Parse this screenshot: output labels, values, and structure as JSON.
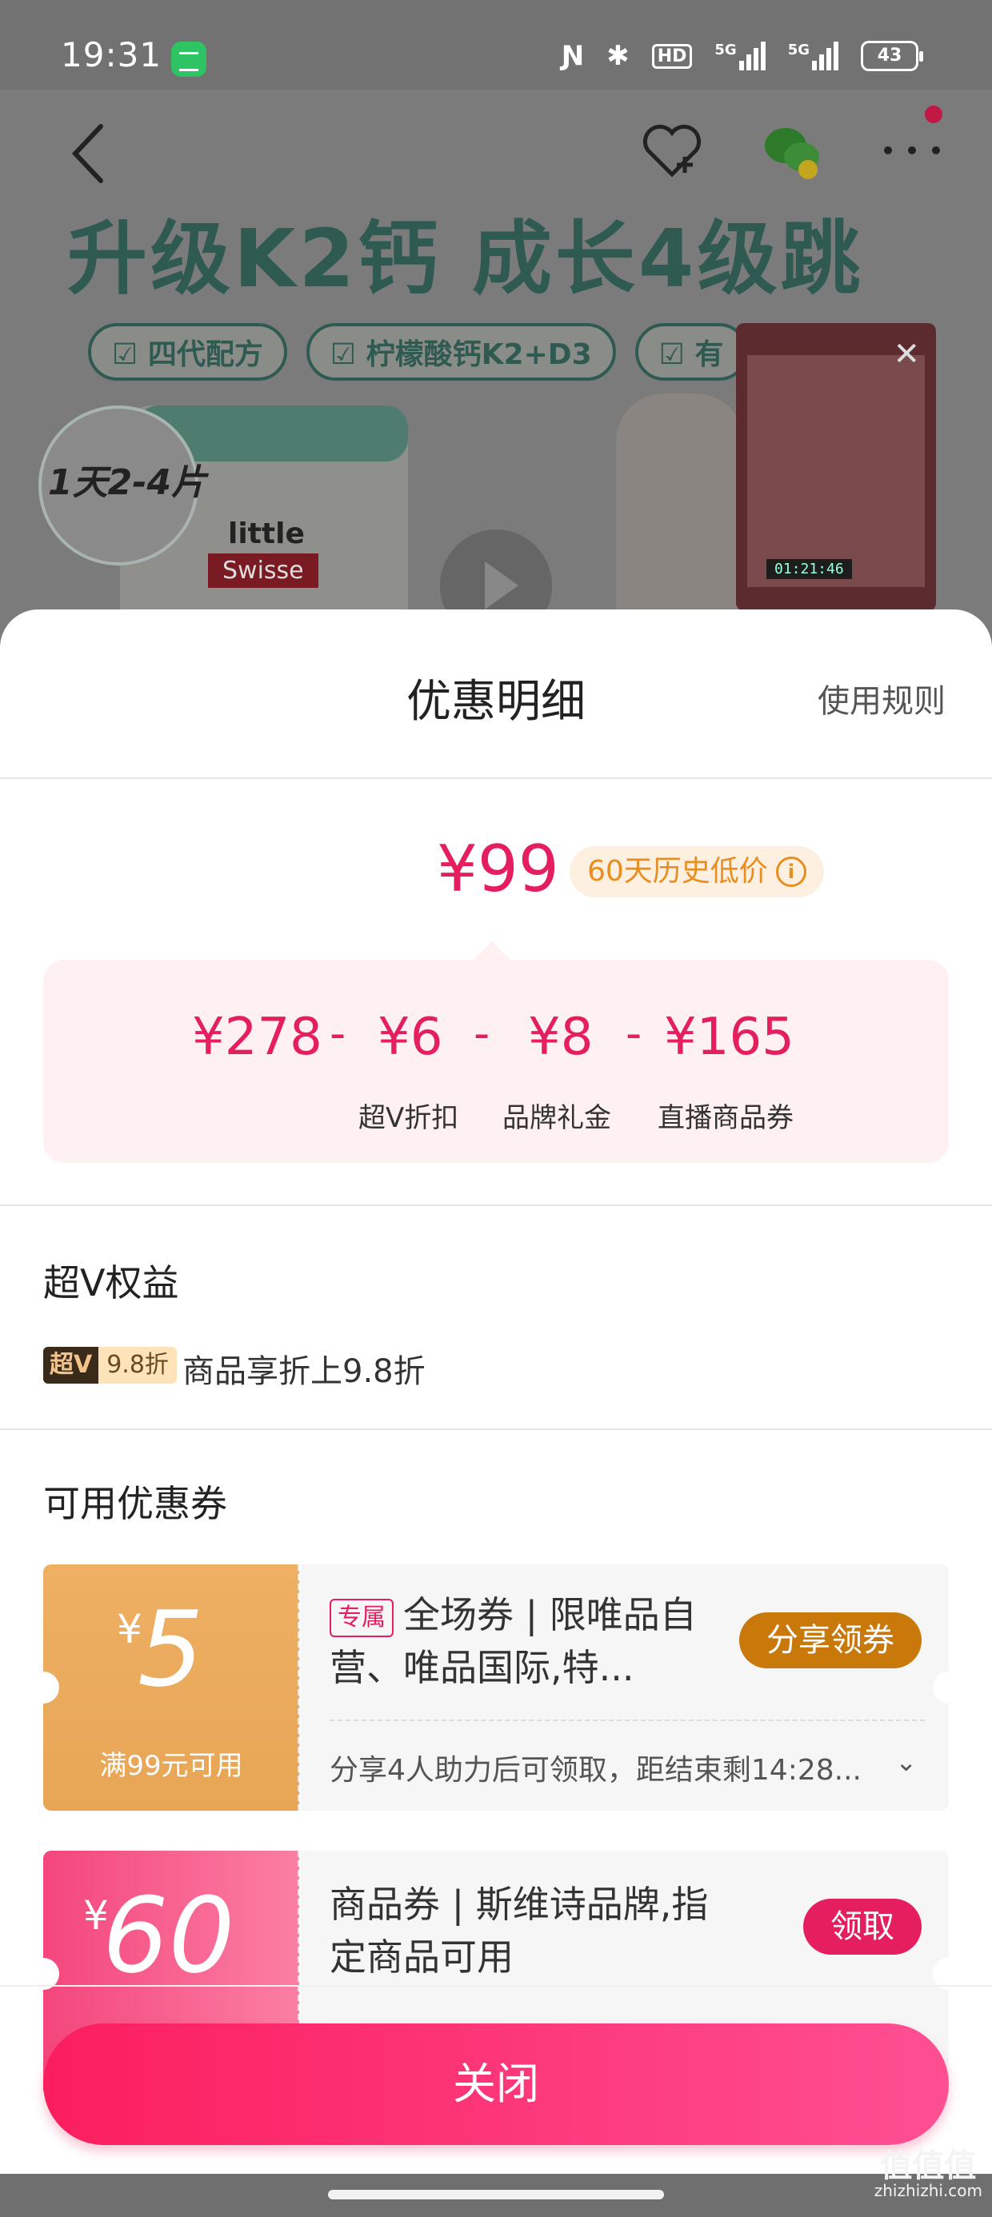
{
  "status_bar": {
    "time": "19:31",
    "battery": "43",
    "network1": "5G",
    "network2": "5G",
    "hd": "HD"
  },
  "banner": {
    "headline": "升级K2钙 成长4级跳",
    "tags": [
      "四代配方",
      "柠檬酸钙K2+D3",
      "有"
    ],
    "badge": "1天2-4片",
    "brand_small": "little",
    "brand_name": "Swisse",
    "live_timer": "01:21:46"
  },
  "sheet": {
    "title": "优惠明细",
    "rules_link": "使用规则",
    "final_price": "¥99",
    "history_badge": "60天历史低价",
    "calc": {
      "original": "¥278",
      "op1": "-",
      "discount1": "¥6",
      "op2": "-",
      "discount2": "¥8",
      "op3": "-",
      "discount3": "¥165",
      "label1": "超V折扣",
      "label2": "品牌礼金",
      "label3": "直播商品券"
    },
    "vip_section": {
      "title": "超V权益",
      "badge_v": "超V",
      "badge_discount": "9.8折",
      "desc": "商品享折上9.8折"
    },
    "coupon_section": {
      "title": "可用优惠券",
      "coupons": [
        {
          "yen": "¥",
          "amount": "5",
          "condition": "满99元可用",
          "exclusive": "专属",
          "title": "全场券 | 限唯品自营、唯品国际,特...",
          "button": "分享领券",
          "note": "分享4人助力后可领取，距结束剩14:28..."
        },
        {
          "yen": "¥",
          "amount": "60",
          "title": "商品券 | 斯维诗品牌,指定商品可用",
          "button": "领取"
        }
      ]
    },
    "close_button": "关闭"
  },
  "watermark": {
    "main": "值值值",
    "sub": "zhizhizhi.com"
  },
  "colors": {
    "accent": "#e51f5f",
    "gold": "#eeb063",
    "pink": "#f4467c",
    "orange": "#e98e1e"
  }
}
